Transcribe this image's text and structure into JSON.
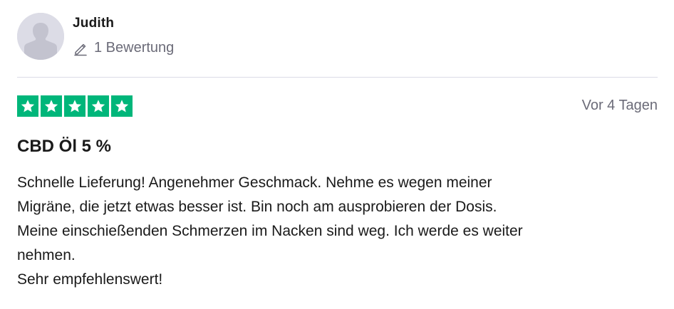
{
  "user": {
    "name": "Judith",
    "review_count_label": "1 Bewertung",
    "avatar_icon": "user-silhouette-icon"
  },
  "review": {
    "rating": 5,
    "rating_max": 5,
    "date": "Vor 4 Tagen",
    "title": "CBD Öl 5 %",
    "body_lines": [
      "Schnelle Lieferung! Angenehmer Geschmack. Nehme es wegen meiner",
      "Migräne, die jetzt etwas besser ist. Bin noch am ausprobieren der Dosis.",
      "Meine einschießenden Schmerzen im Nacken sind weg. Ich werde es weiter",
      "nehmen.",
      "Sehr empfehlenswert!"
    ]
  },
  "icons": {
    "review_count": "pencil-icon",
    "star": "star-icon"
  },
  "colors": {
    "star_green": "#00b67a",
    "muted_text": "#6b6b78",
    "divider": "#dcdce6"
  }
}
